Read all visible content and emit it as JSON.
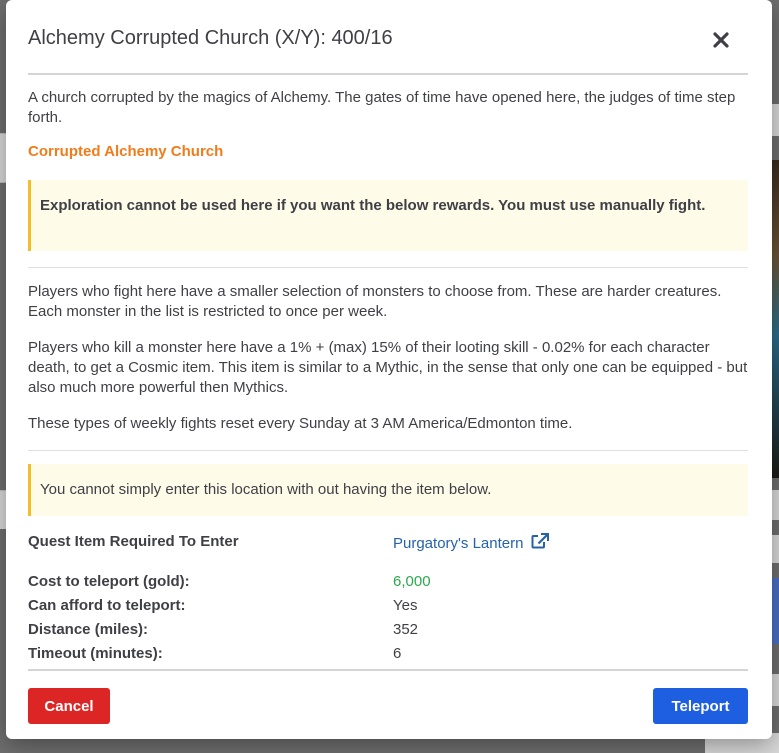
{
  "modal": {
    "title": "Alchemy Corrupted Church (X/Y): 400/16",
    "description": "A church corrupted by the magics of Alchemy. The gates of time have opened here, the judges of time step forth.",
    "location_name": "Corrupted Alchemy Church",
    "warning": "Exploration cannot be used here if you want the below rewards. You must use manually fight.",
    "paragraphs": [
      "Players who fight here have a smaller selection of monsters to choose from. These are harder creatures. Each monster in the list is restricted to once per week.",
      "Players who kill a monster here have a 1% + (max) 15% of their looting skill - 0.02% for each character death, to get a Cosmic item. This item is similar to a Mythic, in the sense that only one can be equipped - but also much more powerful then Mythics.",
      "These types of weekly fights reset every Sunday at 3 AM America/Edmonton time."
    ],
    "item_notice": "You cannot simply enter this location with out having the item below.",
    "quest_item": {
      "label": "Quest Item Required To Enter",
      "value": "Purgatory's Lantern"
    },
    "details": [
      {
        "label": "Cost to teleport (gold):",
        "value": "6,000"
      },
      {
        "label": "Can afford to teleport:",
        "value": "Yes"
      },
      {
        "label": "Distance (miles):",
        "value": "352"
      },
      {
        "label": "Timeout (minutes):",
        "value": "6"
      }
    ],
    "buttons": {
      "cancel": "Cancel",
      "teleport": "Teleport"
    }
  },
  "colors": {
    "location_name": "#f07c1b",
    "alert_bg": "#fefbe8",
    "alert_border": "#f2be29",
    "link": "#2563a8",
    "gold_value": "#2aa84a",
    "cancel_bg": "#dc2626",
    "teleport_bg": "#1d5fe0"
  },
  "icons": {
    "close": "close-icon",
    "external_link": "external-link-icon"
  }
}
